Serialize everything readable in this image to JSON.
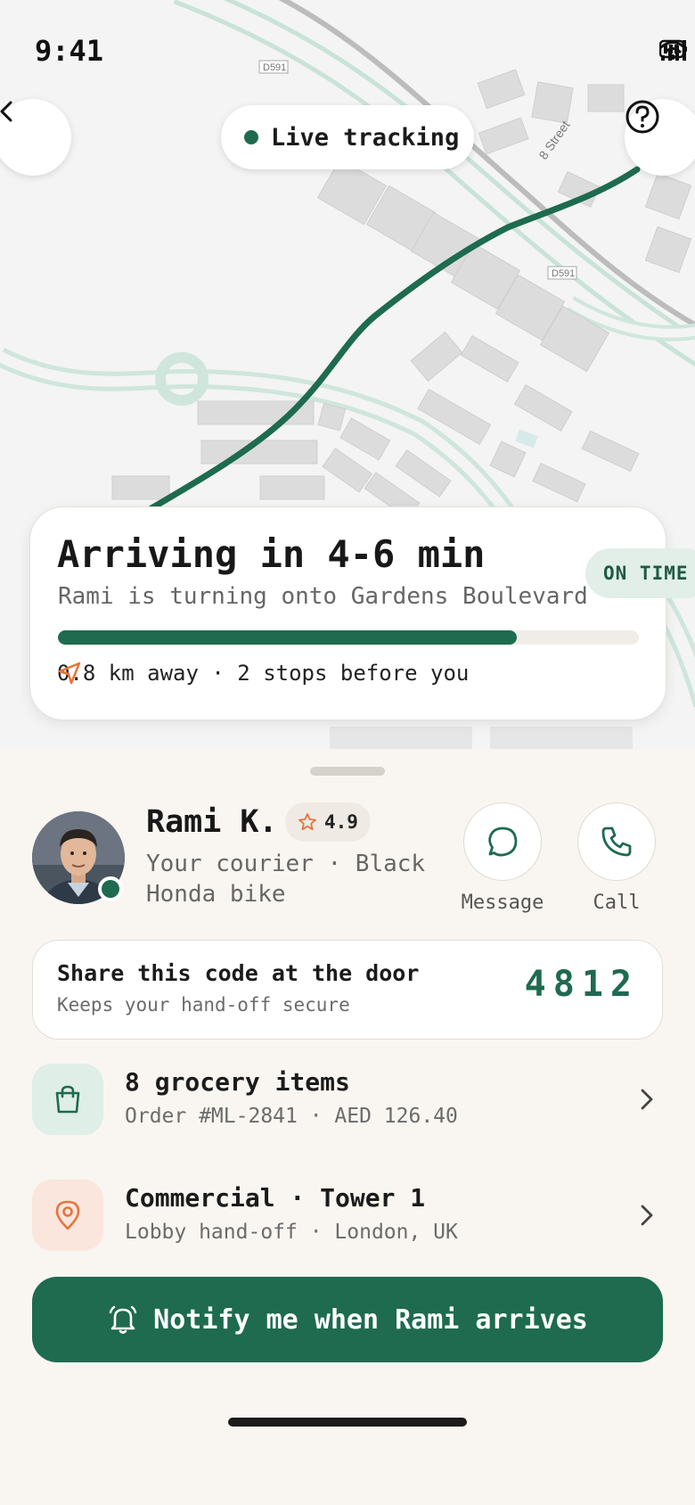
{
  "status_bar": {
    "time": "9:41"
  },
  "map": {
    "live_label": "Live tracking",
    "road_labels": [
      "D591",
      "D591",
      "8 Street"
    ],
    "route_color": "#1e6b4f"
  },
  "eta": {
    "title": "Arriving in 4-6 min",
    "subtitle": "Rami is turning onto Gardens Boulevard",
    "status_badge": "ON TIME",
    "progress": 0.79,
    "meta": "0.8 km away · 2 stops before you"
  },
  "courier": {
    "name": "Rami K.",
    "rating": "4.9",
    "description": "Your courier · Black Honda bike",
    "message_label": "Message",
    "call_label": "Call"
  },
  "code": {
    "title": "Share this code at the door",
    "subtitle": "Keeps your hand-off secure",
    "value": "4812"
  },
  "order": {
    "title": "8 grocery items",
    "subtitle": "Order #ML-2841 · AED 126.40"
  },
  "address": {
    "title": "Commercial · Tower 1",
    "subtitle": "Lobby hand-off · London, UK"
  },
  "notify_button": "Notify me when Rami arrives",
  "colors": {
    "accent": "#1e6b4f",
    "orange": "#e8743b",
    "background": "#f9f6f1"
  },
  "icons": [
    "back-icon",
    "help-icon",
    "navigation-arrow-icon",
    "star-icon",
    "message-icon",
    "phone-icon",
    "shopping-bag-icon",
    "location-pin-icon",
    "chevron-right-icon",
    "bell-icon"
  ]
}
